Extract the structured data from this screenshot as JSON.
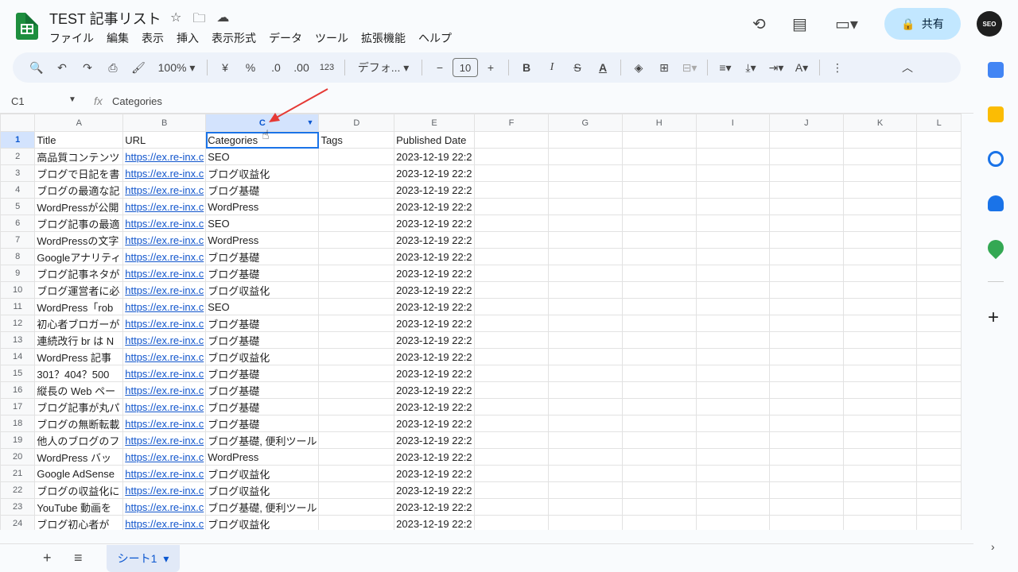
{
  "app": {
    "title": "TEST 記事リスト",
    "share_label": "共有",
    "avatar_text": "SEO"
  },
  "menu": [
    "ファイル",
    "編集",
    "表示",
    "挿入",
    "表示形式",
    "データ",
    "ツール",
    "拡張機能",
    "ヘルプ"
  ],
  "toolbar": {
    "zoom": "100%",
    "currency": "¥",
    "percent": "%",
    "dec_dec": ".0",
    "dec_inc": ".00",
    "number_fmt": "123",
    "font": "デフォ...",
    "font_size": "10"
  },
  "formula_bar": {
    "cell_ref": "C1",
    "fx": "fx",
    "content": "Categories"
  },
  "columns": [
    "A",
    "B",
    "C",
    "D",
    "E",
    "F",
    "G",
    "H",
    "I",
    "J",
    "K",
    "L"
  ],
  "selected_column": "C",
  "header_row": [
    "Title",
    "URL",
    "Categories",
    "Tags",
    "Published Date"
  ],
  "rows": [
    [
      "高品質コンテンツ",
      "https://ex.re-inx.c",
      "SEO",
      "",
      "2023-12-19 22:2"
    ],
    [
      "ブログで日記を書",
      "https://ex.re-inx.c",
      "ブログ収益化",
      "",
      "2023-12-19 22:2"
    ],
    [
      "ブログの最適な記",
      "https://ex.re-inx.c",
      "ブログ基礎",
      "",
      "2023-12-19 22:2"
    ],
    [
      "WordPressが公開",
      "https://ex.re-inx.c",
      "WordPress",
      "",
      "2023-12-19 22:2"
    ],
    [
      "ブログ記事の最適",
      "https://ex.re-inx.c",
      "SEO",
      "",
      "2023-12-19 22:2"
    ],
    [
      "WordPressの文字",
      "https://ex.re-inx.c",
      "WordPress",
      "",
      "2023-12-19 22:2"
    ],
    [
      "Googleアナリティ",
      "https://ex.re-inx.c",
      "ブログ基礎",
      "",
      "2023-12-19 22:2"
    ],
    [
      "ブログ記事ネタが",
      "https://ex.re-inx.c",
      "ブログ基礎",
      "",
      "2023-12-19 22:2"
    ],
    [
      "ブログ運営者に必",
      "https://ex.re-inx.c",
      "ブログ収益化",
      "",
      "2023-12-19 22:2"
    ],
    [
      "WordPress「rob",
      "https://ex.re-inx.c",
      "SEO",
      "",
      "2023-12-19 22:2"
    ],
    [
      "初心者ブロガーが",
      "https://ex.re-inx.c",
      "ブログ基礎",
      "",
      "2023-12-19 22:2"
    ],
    [
      "連続改行 br は N",
      "https://ex.re-inx.c",
      "ブログ基礎",
      "",
      "2023-12-19 22:2"
    ],
    [
      "WordPress 記事",
      "https://ex.re-inx.c",
      "ブログ収益化",
      "",
      "2023-12-19 22:2"
    ],
    [
      "301？404？500",
      "https://ex.re-inx.c",
      "ブログ基礎",
      "",
      "2023-12-19 22:2"
    ],
    [
      "縦長の Web ペー",
      "https://ex.re-inx.c",
      "ブログ基礎",
      "",
      "2023-12-19 22:2"
    ],
    [
      "ブログ記事が丸パ",
      "https://ex.re-inx.c",
      "ブログ基礎",
      "",
      "2023-12-19 22:2"
    ],
    [
      "ブログの無断転載",
      "https://ex.re-inx.c",
      "ブログ基礎",
      "",
      "2023-12-19 22:2"
    ],
    [
      "他人のブログのフ",
      "https://ex.re-inx.c",
      "ブログ基礎, 便利ツール",
      "",
      "2023-12-19 22:2"
    ],
    [
      "WordPress バッ",
      "https://ex.re-inx.c",
      "WordPress",
      "",
      "2023-12-19 22:2"
    ],
    [
      "Google AdSense",
      "https://ex.re-inx.c",
      "ブログ収益化",
      "",
      "2023-12-19 22:2"
    ],
    [
      "ブログの収益化に",
      "https://ex.re-inx.c",
      "ブログ収益化",
      "",
      "2023-12-19 22:2"
    ],
    [
      "YouTube 動画を",
      "https://ex.re-inx.c",
      "ブログ基礎, 便利ツール",
      "",
      "2023-12-19 22:2"
    ],
    [
      "ブログ初心者が",
      "https://ex.re-inx.c",
      "ブログ収益化",
      "",
      "2023-12-19 22:2"
    ]
  ],
  "bottom": {
    "sheet_tab": "シート1"
  }
}
